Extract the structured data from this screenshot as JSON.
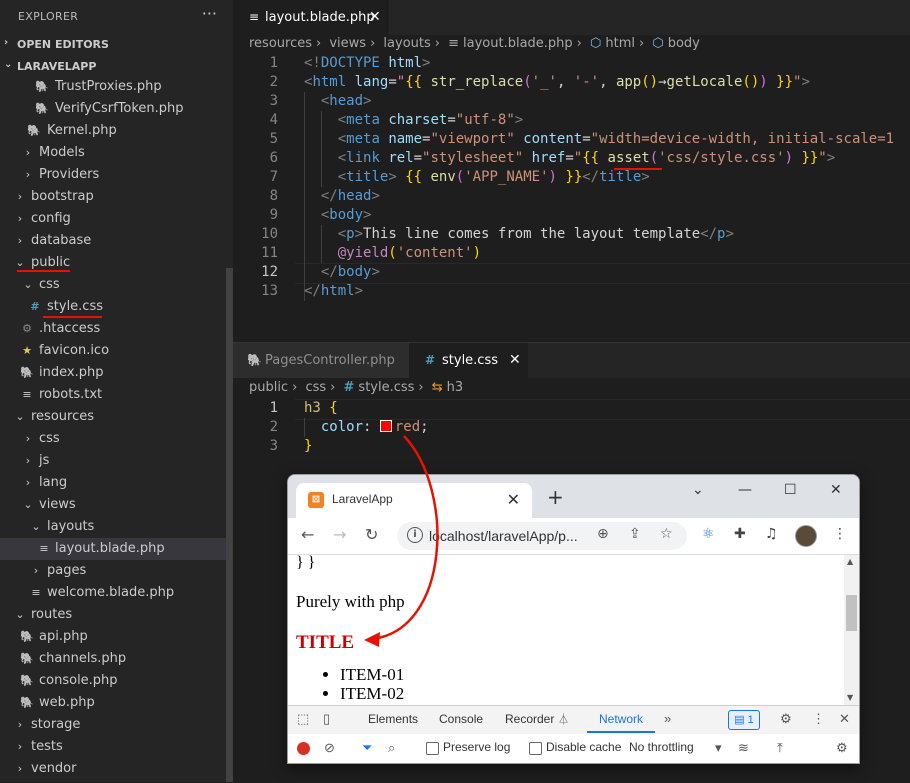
{
  "explorer": {
    "title": "EXPLORER",
    "more": "···",
    "open_editors": "OPEN EDITORS",
    "project": "LARAVELAPP",
    "items": [
      {
        "label": "TrustProxies.php"
      },
      {
        "label": "VerifyCsrfToken.php"
      },
      {
        "label": "Kernel.php"
      },
      {
        "label": "Models"
      },
      {
        "label": "Providers"
      },
      {
        "label": "bootstrap"
      },
      {
        "label": "config"
      },
      {
        "label": "database"
      },
      {
        "label": "public"
      },
      {
        "label": "css"
      },
      {
        "label": "style.css"
      },
      {
        "label": ".htaccess"
      },
      {
        "label": "favicon.ico"
      },
      {
        "label": "index.php"
      },
      {
        "label": "robots.txt"
      },
      {
        "label": "resources"
      },
      {
        "label": "css"
      },
      {
        "label": "js"
      },
      {
        "label": "lang"
      },
      {
        "label": "views"
      },
      {
        "label": "layouts"
      },
      {
        "label": "layout.blade.php"
      },
      {
        "label": "pages"
      },
      {
        "label": "welcome.blade.php"
      },
      {
        "label": "routes"
      },
      {
        "label": "api.php"
      },
      {
        "label": "channels.php"
      },
      {
        "label": "console.php"
      },
      {
        "label": "web.php"
      },
      {
        "label": "storage"
      },
      {
        "label": "tests"
      },
      {
        "label": "vendor"
      }
    ]
  },
  "editor_top": {
    "tab_label": "layout.blade.php",
    "breadcrumb": [
      "resources",
      "views",
      "layouts",
      "layout.blade.php",
      "html",
      "body"
    ],
    "line_numbers": [
      "1",
      "2",
      "3",
      "4",
      "5",
      "6",
      "7",
      "8",
      "9",
      "10",
      "11",
      "12",
      "13"
    ]
  },
  "editor_bottom": {
    "tabs": [
      "PagesController.php",
      "style.css"
    ],
    "breadcrumb": [
      "public",
      "css",
      "style.css",
      "h3"
    ],
    "line_numbers": [
      "1",
      "2",
      "3"
    ]
  },
  "browser": {
    "tab_title": "LaravelApp",
    "url": "localhost/laravelApp/p...",
    "page": {
      "line1": "} }",
      "line2": "Purely with php",
      "heading": "TITLE",
      "items": [
        "ITEM-01",
        "ITEM-02"
      ]
    },
    "devtools": {
      "tabs": [
        "Elements",
        "Console",
        "Recorder",
        "Network"
      ],
      "badge": "1",
      "preserve_log": "Preserve log",
      "disable_cache": "Disable cache",
      "throttling": "No throttling"
    }
  },
  "colors": {
    "annotation_red": "#e51400",
    "heading_red": "#cc0000"
  }
}
